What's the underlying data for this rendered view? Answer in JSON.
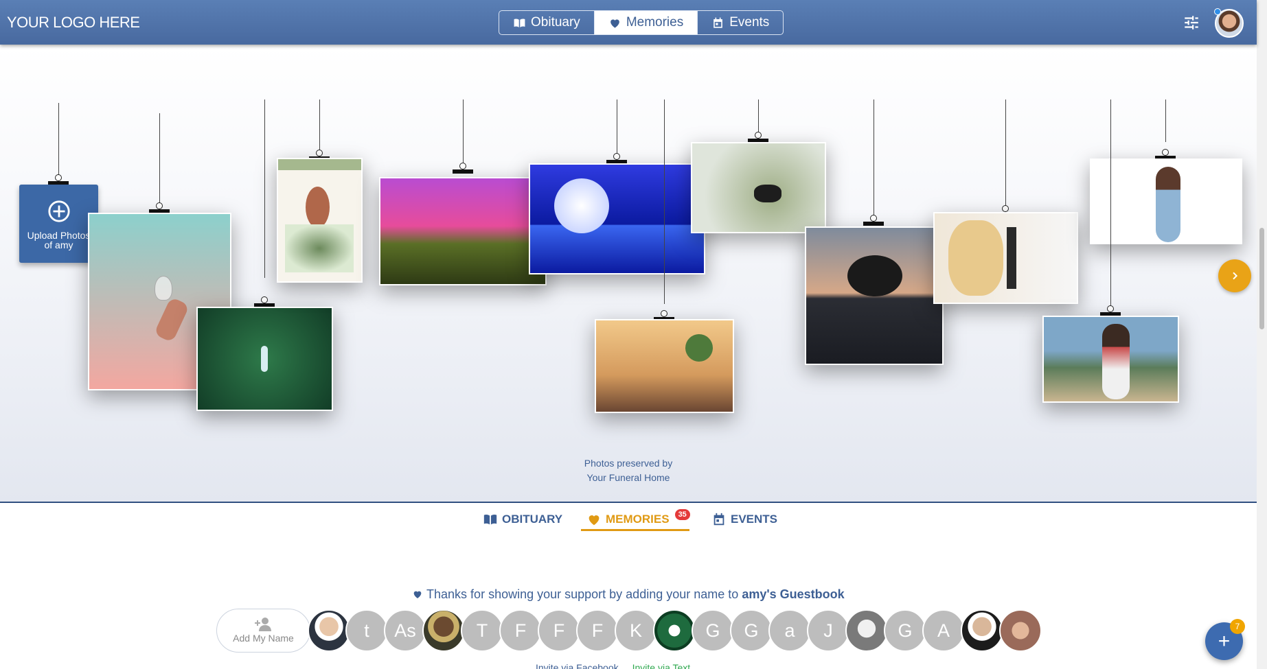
{
  "header": {
    "logo_text": "YOUR LOGO HERE",
    "nav": [
      {
        "label": "Obituary",
        "icon": "book-icon"
      },
      {
        "label": "Memories",
        "icon": "heart-icon",
        "active": true
      },
      {
        "label": "Events",
        "icon": "calendar-icon"
      }
    ],
    "filter_icon": "sliders-icon"
  },
  "gallery": {
    "upload_label_line1": "Upload Photos",
    "upload_label_line2": "of amy",
    "preserved_line1": "Photos preserved by",
    "preserved_line2": "Your Funeral Home",
    "next_icon": "chevron-right-icon",
    "photos": [
      {
        "name": "lightbulb-photo",
        "colors": [
          "#8cd0cc",
          "#f3a7a0"
        ]
      },
      {
        "name": "forest-photo",
        "colors": [
          "#1f5a3a",
          "#2e7a4a"
        ]
      },
      {
        "name": "bird-illustration-photo",
        "colors": [
          "#f7f4ec",
          "#a5b88e"
        ]
      },
      {
        "name": "pink-sky-photo",
        "colors": [
          "#e74c9b",
          "#5a6f26"
        ]
      },
      {
        "name": "moon-ocean-photo",
        "colors": [
          "#3a49e6",
          "#0b1aa0"
        ]
      },
      {
        "name": "butterfly-photo",
        "colors": [
          "#cfd8c8",
          "#5d7a3c"
        ]
      },
      {
        "name": "open-book-photo",
        "colors": [
          "#f2c98a",
          "#6a4632"
        ]
      },
      {
        "name": "tree-reflection-photo",
        "colors": [
          "#7f8b9c",
          "#2b2d34"
        ]
      },
      {
        "name": "headphones-photo",
        "colors": [
          "#f6f6f6",
          "#d9b77a"
        ]
      },
      {
        "name": "woman-denim-photo",
        "colors": [
          "#ffffff",
          "#8fb4d4"
        ]
      },
      {
        "name": "woman-beach-photo",
        "colors": [
          "#7ea7c8",
          "#c9b590"
        ]
      }
    ]
  },
  "tabs": [
    {
      "label": "OBITUARY",
      "icon": "book-icon"
    },
    {
      "label": "MEMORIES",
      "icon": "heart-icon",
      "badge": "35",
      "active": true
    },
    {
      "label": "EVENTS",
      "icon": "calendar-icon"
    }
  ],
  "guestbook": {
    "prefix": "Thanks for showing your support by adding your name to",
    "highlight": "amy's Guestbook",
    "add_label": "Add My Name",
    "guests": [
      "photo",
      "t",
      "As",
      "photo",
      "T",
      "F",
      "F",
      "F",
      "K",
      "photo",
      "G",
      "G",
      "a",
      "J",
      "photo",
      "G",
      "A",
      "photo",
      "photo"
    ]
  },
  "fab": {
    "label": "+",
    "badge": "7"
  },
  "invites": {
    "facebook": "Invite via Facebook",
    "text": "Invite via Text"
  }
}
